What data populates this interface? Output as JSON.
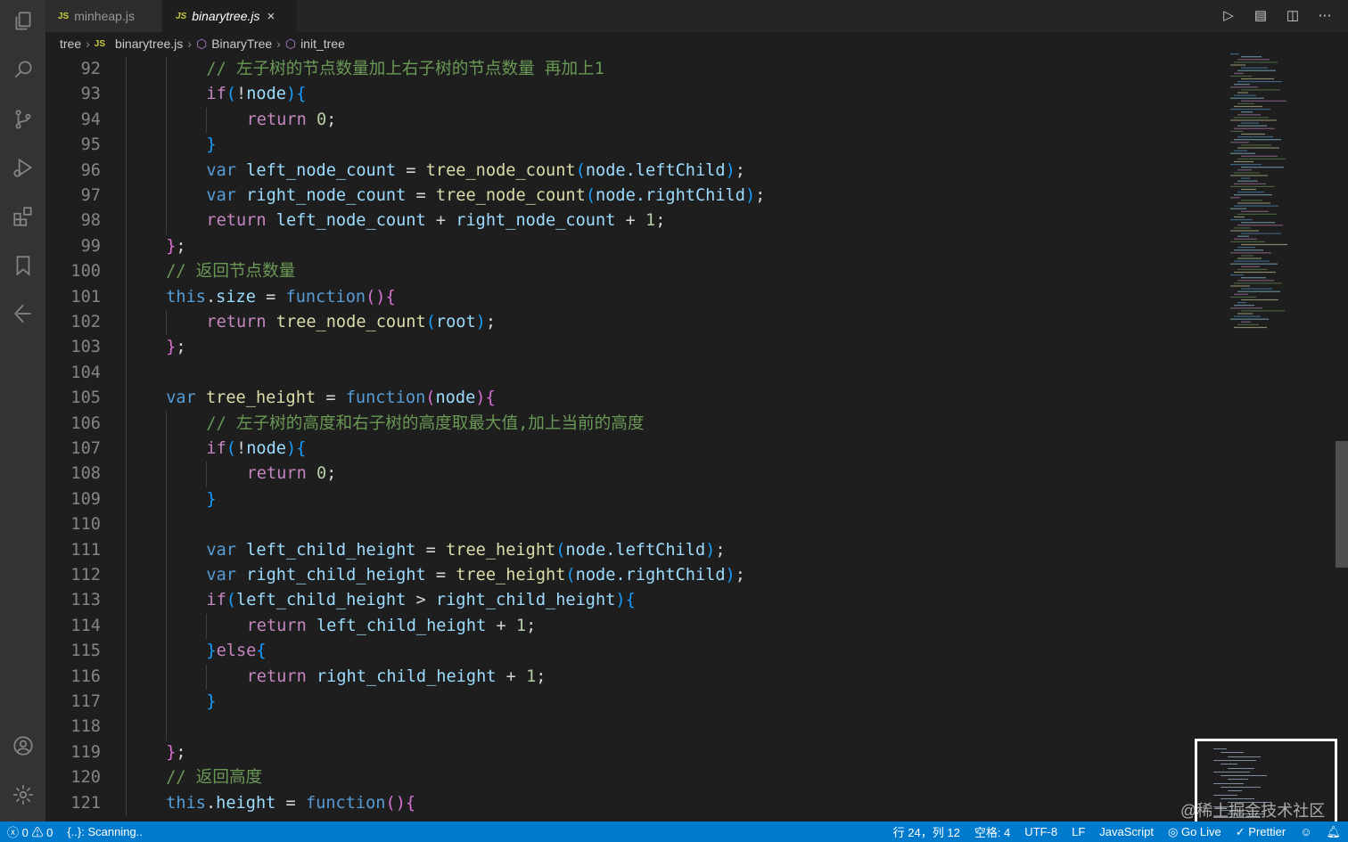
{
  "tabs": [
    {
      "label": "minheap.js",
      "badge": "JS"
    },
    {
      "label": "binarytree.js",
      "badge": "JS",
      "close": "×"
    }
  ],
  "breadcrumb": [
    "tree",
    "binarytree.js",
    "BinaryTree",
    "init_tree"
  ],
  "code": [
    {
      "n": "92",
      "i": 2,
      "t": [
        [
          "c",
          "// 左子树的节点数量加上右子树的节点数量 再加上1"
        ]
      ]
    },
    {
      "n": "93",
      "i": 2,
      "t": [
        [
          "ct",
          "if"
        ],
        [
          "b2",
          "("
        ],
        [
          "p",
          "!"
        ],
        [
          "v",
          "node"
        ],
        [
          "b2",
          ")"
        ],
        [
          "b2",
          "{"
        ]
      ]
    },
    {
      "n": "94",
      "i": 3,
      "t": [
        [
          "ct",
          "return"
        ],
        [
          "p",
          " "
        ],
        [
          "n",
          "0"
        ],
        [
          "p",
          ";"
        ]
      ]
    },
    {
      "n": "95",
      "i": 2,
      "t": [
        [
          "b2",
          "}"
        ]
      ]
    },
    {
      "n": "96",
      "i": 2,
      "t": [
        [
          "kw",
          "var"
        ],
        [
          "v",
          " left_node_count"
        ],
        [
          "p",
          " = "
        ],
        [
          "fn",
          "tree_node_count"
        ],
        [
          "b2",
          "("
        ],
        [
          "v",
          "node.leftChild"
        ],
        [
          "b2",
          ")"
        ],
        [
          "p",
          ";"
        ]
      ]
    },
    {
      "n": "97",
      "i": 2,
      "t": [
        [
          "kw",
          "var"
        ],
        [
          "v",
          " right_node_count"
        ],
        [
          "p",
          " = "
        ],
        [
          "fn",
          "tree_node_count"
        ],
        [
          "b2",
          "("
        ],
        [
          "v",
          "node.rightChild"
        ],
        [
          "b2",
          ")"
        ],
        [
          "p",
          ";"
        ]
      ]
    },
    {
      "n": "98",
      "i": 2,
      "t": [
        [
          "ct",
          "return"
        ],
        [
          "v",
          " left_node_count"
        ],
        [
          "p",
          " + "
        ],
        [
          "v",
          "right_node_count"
        ],
        [
          "p",
          " + "
        ],
        [
          "n",
          "1"
        ],
        [
          "p",
          ";"
        ]
      ]
    },
    {
      "n": "99",
      "i": 1,
      "t": [
        [
          "b",
          "}"
        ],
        [
          "p",
          ";"
        ]
      ]
    },
    {
      "n": "100",
      "i": 1,
      "t": [
        [
          "c",
          "// 返回节点数量"
        ]
      ]
    },
    {
      "n": "101",
      "i": 1,
      "t": [
        [
          "kw",
          "this"
        ],
        [
          "p",
          "."
        ],
        [
          "v",
          "size"
        ],
        [
          "p",
          " = "
        ],
        [
          "kw",
          "function"
        ],
        [
          "b",
          "()"
        ],
        [
          "b",
          "{"
        ]
      ]
    },
    {
      "n": "102",
      "i": 2,
      "t": [
        [
          "ct",
          "return"
        ],
        [
          "p",
          " "
        ],
        [
          "fn",
          "tree_node_count"
        ],
        [
          "b2",
          "("
        ],
        [
          "v",
          "root"
        ],
        [
          "b2",
          ")"
        ],
        [
          "p",
          ";"
        ]
      ]
    },
    {
      "n": "103",
      "i": 1,
      "t": [
        [
          "b",
          "}"
        ],
        [
          "p",
          ";"
        ]
      ]
    },
    {
      "n": "104",
      "i": 1,
      "t": []
    },
    {
      "n": "105",
      "i": 1,
      "t": [
        [
          "kw",
          "var"
        ],
        [
          "fn",
          " tree_height"
        ],
        [
          "p",
          " = "
        ],
        [
          "kw",
          "function"
        ],
        [
          "b",
          "("
        ],
        [
          "v",
          "node"
        ],
        [
          "b",
          ")"
        ],
        [
          "b",
          "{"
        ]
      ]
    },
    {
      "n": "106",
      "i": 2,
      "t": [
        [
          "c",
          "// 左子树的高度和右子树的高度取最大值,加上当前的高度"
        ]
      ]
    },
    {
      "n": "107",
      "i": 2,
      "t": [
        [
          "ct",
          "if"
        ],
        [
          "b2",
          "("
        ],
        [
          "p",
          "!"
        ],
        [
          "v",
          "node"
        ],
        [
          "b2",
          ")"
        ],
        [
          "b2",
          "{"
        ]
      ]
    },
    {
      "n": "108",
      "i": 3,
      "t": [
        [
          "ct",
          "return"
        ],
        [
          "p",
          " "
        ],
        [
          "n",
          "0"
        ],
        [
          "p",
          ";"
        ]
      ]
    },
    {
      "n": "109",
      "i": 2,
      "t": [
        [
          "b2",
          "}"
        ]
      ]
    },
    {
      "n": "110",
      "i": 2,
      "t": []
    },
    {
      "n": "111",
      "i": 2,
      "t": [
        [
          "kw",
          "var"
        ],
        [
          "v",
          " left_child_height"
        ],
        [
          "p",
          " = "
        ],
        [
          "fn",
          "tree_height"
        ],
        [
          "b2",
          "("
        ],
        [
          "v",
          "node.leftChild"
        ],
        [
          "b2",
          ")"
        ],
        [
          "p",
          ";"
        ]
      ]
    },
    {
      "n": "112",
      "i": 2,
      "t": [
        [
          "kw",
          "var"
        ],
        [
          "v",
          " right_child_height"
        ],
        [
          "p",
          " = "
        ],
        [
          "fn",
          "tree_height"
        ],
        [
          "b2",
          "("
        ],
        [
          "v",
          "node.rightChild"
        ],
        [
          "b2",
          ")"
        ],
        [
          "p",
          ";"
        ]
      ]
    },
    {
      "n": "113",
      "i": 2,
      "t": [
        [
          "ct",
          "if"
        ],
        [
          "b2",
          "("
        ],
        [
          "v",
          "left_child_height"
        ],
        [
          "p",
          " > "
        ],
        [
          "v",
          "right_child_height"
        ],
        [
          "b2",
          ")"
        ],
        [
          "b2",
          "{"
        ]
      ]
    },
    {
      "n": "114",
      "i": 3,
      "t": [
        [
          "ct",
          "return"
        ],
        [
          "v",
          " left_child_height"
        ],
        [
          "p",
          " + "
        ],
        [
          "n",
          "1"
        ],
        [
          "p",
          ";"
        ]
      ]
    },
    {
      "n": "115",
      "i": 2,
      "t": [
        [
          "b2",
          "}"
        ],
        [
          "ct",
          "else"
        ],
        [
          "b2",
          "{"
        ]
      ]
    },
    {
      "n": "116",
      "i": 3,
      "t": [
        [
          "ct",
          "return"
        ],
        [
          "v",
          " right_child_height"
        ],
        [
          "p",
          " + "
        ],
        [
          "n",
          "1"
        ],
        [
          "p",
          ";"
        ]
      ]
    },
    {
      "n": "117",
      "i": 2,
      "t": [
        [
          "b2",
          "}"
        ]
      ]
    },
    {
      "n": "118",
      "i": 2,
      "t": []
    },
    {
      "n": "119",
      "i": 1,
      "t": [
        [
          "b",
          "}"
        ],
        [
          "p",
          ";"
        ]
      ]
    },
    {
      "n": "120",
      "i": 1,
      "t": [
        [
          "c",
          "// 返回高度"
        ]
      ]
    },
    {
      "n": "121",
      "i": 1,
      "t": [
        [
          "kw",
          "this"
        ],
        [
          "p",
          "."
        ],
        [
          "v",
          "height"
        ],
        [
          "p",
          " = "
        ],
        [
          "kw",
          "function"
        ],
        [
          "b",
          "()"
        ],
        [
          "b",
          "{"
        ]
      ]
    }
  ],
  "status": {
    "errors": "0",
    "warnings": "0",
    "scanning": "{..}: Scanning..",
    "position": "行 24，列 12",
    "spaces": "空格: 4",
    "encoding": "UTF-8",
    "eol": "LF",
    "language": "JavaScript",
    "golive": "Go Live",
    "prettier": "Prettier"
  },
  "watermark": "@稀土掘金技术社区"
}
